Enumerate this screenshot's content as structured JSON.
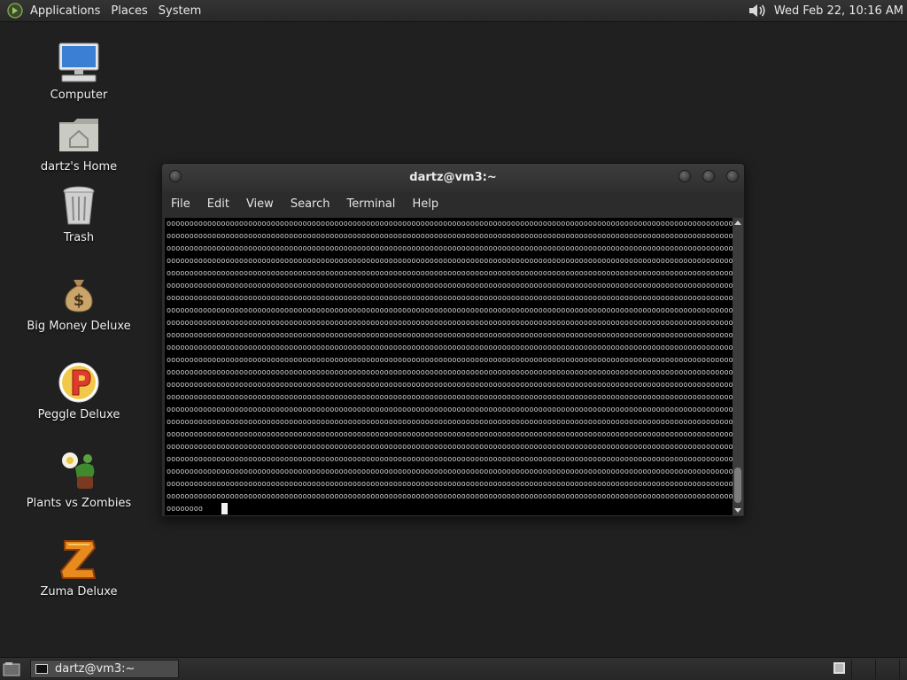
{
  "top_panel": {
    "menus": [
      "Applications",
      "Places",
      "System"
    ],
    "clock": "Wed Feb 22, 10:16 AM",
    "icons": {
      "logo": "foot-logo-icon",
      "volume": "volume-icon"
    }
  },
  "desktop": {
    "icons": [
      {
        "label": "Computer",
        "icon": "computer-icon"
      },
      {
        "label": "dartz's Home",
        "icon": "home-folder-icon"
      },
      {
        "label": "Trash",
        "icon": "trash-icon"
      },
      {
        "label": "Big Money Deluxe",
        "icon": "money-bag-icon"
      },
      {
        "label": "Peggle Deluxe",
        "icon": "peggle-icon"
      },
      {
        "label": "Plants vs Zombies",
        "icon": "plants-vs-zombies-icon"
      },
      {
        "label": "Zuma Deluxe",
        "icon": "zuma-icon"
      }
    ]
  },
  "terminal": {
    "title": "dartz@vm3:~",
    "menus": [
      "File",
      "Edit",
      "View",
      "Search",
      "Terminal",
      "Help"
    ],
    "output_line": "oooooooooooooooooooooooooooooooooooooooooooooooooooooooooooooooooooooooooooooooooooooooooooooooooooooooooooooooooooooooooooooooo",
    "prompt_line": "oooooooo",
    "full_line_count": 23
  },
  "bottom_panel": {
    "task_label": "dartz@vm3:~",
    "workspaces": 4,
    "active_workspace": 1
  },
  "colors": {
    "desktop_bg": "#1f201f",
    "panel_bg": "#2b2c2b",
    "terminal_bg": "#000000",
    "terminal_fg": "#c8c8c8"
  }
}
